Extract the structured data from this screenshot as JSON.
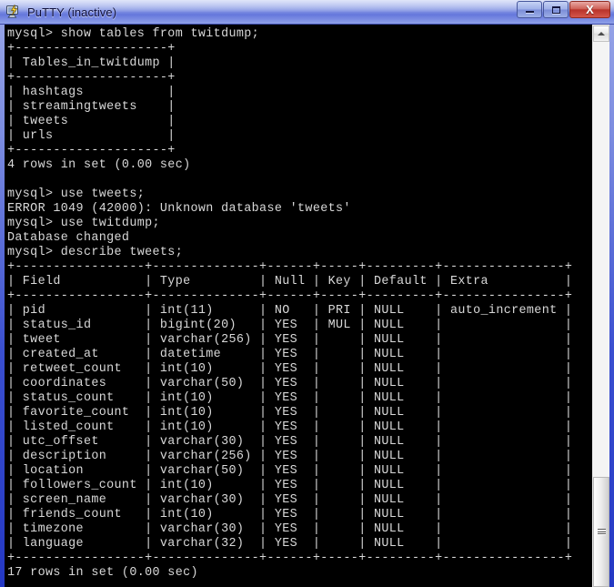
{
  "window": {
    "title": "PuTTY (inactive)",
    "icon": "putty-terminal-icon",
    "controls": {
      "minimize_label": "Minimize",
      "maximize_label": "Maximize",
      "close_label": "X"
    },
    "colors": {
      "terminal_bg": "#000000",
      "terminal_fg": "#d8d8d8",
      "titlebar_accent": "#6577dc",
      "close_button": "#b8332a"
    }
  },
  "scrollbar": {
    "up_arrow": "scroll-up-arrow-icon",
    "thumb_label": "scroll-thumb"
  },
  "terminal": {
    "lines": [
      "mysql> show tables from twitdump;",
      "+--------------------+",
      "| Tables_in_twitdump |",
      "+--------------------+",
      "| hashtags           |",
      "| streamingtweets    |",
      "| tweets             |",
      "| urls               |",
      "+--------------------+",
      "4 rows in set (0.00 sec)",
      "",
      "mysql> use tweets;",
      "ERROR 1049 (42000): Unknown database 'tweets'",
      "mysql> use twitdump;",
      "Database changed",
      "mysql> describe tweets;",
      "+-----------------+--------------+------+-----+---------+----------------+",
      "| Field           | Type         | Null | Key | Default | Extra          |",
      "+-----------------+--------------+------+-----+---------+----------------+",
      "| pid             | int(11)      | NO   | PRI | NULL    | auto_increment |",
      "| status_id       | bigint(20)   | YES  | MUL | NULL    |                |",
      "| tweet           | varchar(256) | YES  |     | NULL    |                |",
      "| created_at      | datetime     | YES  |     | NULL    |                |",
      "| retweet_count   | int(10)      | YES  |     | NULL    |                |",
      "| coordinates     | varchar(50)  | YES  |     | NULL    |                |",
      "| status_count    | int(10)      | YES  |     | NULL    |                |",
      "| favorite_count  | int(10)      | YES  |     | NULL    |                |",
      "| listed_count    | int(10)      | YES  |     | NULL    |                |",
      "| utc_offset      | varchar(30)  | YES  |     | NULL    |                |",
      "| description     | varchar(256) | YES  |     | NULL    |                |",
      "| location        | varchar(50)  | YES  |     | NULL    |                |",
      "| followers_count | int(10)      | YES  |     | NULL    |                |",
      "| screen_name     | varchar(30)  | YES  |     | NULL    |                |",
      "| friends_count   | int(10)      | YES  |     | NULL    |                |",
      "| timezone        | varchar(30)  | YES  |     | NULL    |                |",
      "| language        | varchar(32)  | YES  |     | NULL    |                |",
      "+-----------------+--------------+------+-----+---------+----------------+",
      "17 rows in set (0.00 sec)"
    ],
    "commands": [
      "show tables from twitdump;",
      "use tweets;",
      "use twitdump;",
      "describe tweets;"
    ],
    "prompt": "mysql>",
    "database": "twitdump",
    "tables": [
      "hashtags",
      "streamingtweets",
      "tweets",
      "urls"
    ],
    "tables_result": "4 rows in set (0.00 sec)",
    "error": "ERROR 1049 (42000): Unknown database 'tweets'",
    "status_message": "Database changed",
    "describe_result": "17 rows in set (0.00 sec)",
    "describe": {
      "table": "tweets",
      "columns": [
        "Field",
        "Type",
        "Null",
        "Key",
        "Default",
        "Extra"
      ],
      "rows": [
        [
          "pid",
          "int(11)",
          "NO",
          "PRI",
          "NULL",
          "auto_increment"
        ],
        [
          "status_id",
          "bigint(20)",
          "YES",
          "MUL",
          "NULL",
          ""
        ],
        [
          "tweet",
          "varchar(256)",
          "YES",
          "",
          "NULL",
          ""
        ],
        [
          "created_at",
          "datetime",
          "YES",
          "",
          "NULL",
          ""
        ],
        [
          "retweet_count",
          "int(10)",
          "YES",
          "",
          "NULL",
          ""
        ],
        [
          "coordinates",
          "varchar(50)",
          "YES",
          "",
          "NULL",
          ""
        ],
        [
          "status_count",
          "int(10)",
          "YES",
          "",
          "NULL",
          ""
        ],
        [
          "favorite_count",
          "int(10)",
          "YES",
          "",
          "NULL",
          ""
        ],
        [
          "listed_count",
          "int(10)",
          "YES",
          "",
          "NULL",
          ""
        ],
        [
          "utc_offset",
          "varchar(30)",
          "YES",
          "",
          "NULL",
          ""
        ],
        [
          "description",
          "varchar(256)",
          "YES",
          "",
          "NULL",
          ""
        ],
        [
          "location",
          "varchar(50)",
          "YES",
          "",
          "NULL",
          ""
        ],
        [
          "followers_count",
          "int(10)",
          "YES",
          "",
          "NULL",
          ""
        ],
        [
          "screen_name",
          "varchar(30)",
          "YES",
          "",
          "NULL",
          ""
        ],
        [
          "friends_count",
          "int(10)",
          "YES",
          "",
          "NULL",
          ""
        ],
        [
          "timezone",
          "varchar(30)",
          "YES",
          "",
          "NULL",
          ""
        ],
        [
          "language",
          "varchar(32)",
          "YES",
          "",
          "NULL",
          ""
        ]
      ]
    }
  }
}
